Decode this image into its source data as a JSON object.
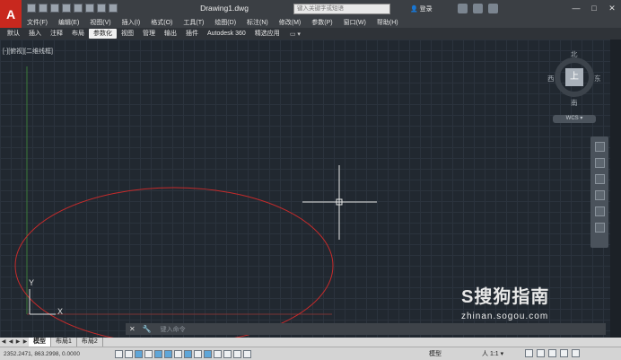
{
  "app": {
    "logo_letter": "A",
    "doc_title": "Drawing1.dwg"
  },
  "search": {
    "placeholder": "键入关键字或短语"
  },
  "login": {
    "label": "登录"
  },
  "window_buttons": {
    "minimize": "—",
    "maximize": "□",
    "close": "✕"
  },
  "menus": [
    "文件(F)",
    "编辑(E)",
    "视图(V)",
    "插入(I)",
    "格式(O)",
    "工具(T)",
    "绘图(D)",
    "标注(N)",
    "修改(M)",
    "参数(P)",
    "窗口(W)",
    "帮助(H)"
  ],
  "ribbon_tabs": [
    {
      "label": "默认",
      "active": false
    },
    {
      "label": "插入",
      "active": false
    },
    {
      "label": "注释",
      "active": false
    },
    {
      "label": "布局",
      "active": false
    },
    {
      "label": "参数化",
      "active": true
    },
    {
      "label": "视图",
      "active": false
    },
    {
      "label": "管理",
      "active": false
    },
    {
      "label": "输出",
      "active": false
    },
    {
      "label": "插件",
      "active": false
    },
    {
      "label": "Autodesk 360",
      "active": false
    },
    {
      "label": "精选应用",
      "active": false
    }
  ],
  "ribbon_more": "▭ ▾",
  "viewport": {
    "label": "[-][俯视][二维线框]"
  },
  "viewcube": {
    "north": "北",
    "south": "南",
    "east": "东",
    "west": "西",
    "face": "上",
    "wcs": "WCS ▾"
  },
  "ucs": {
    "x_label": "X",
    "y_label": "Y"
  },
  "command": {
    "placeholder": "键入命令",
    "close": "✕",
    "tool": "🔧"
  },
  "watermark": {
    "logo": "S搜狗指南",
    "url": "zhinan.sogou.com"
  },
  "layout_tabs": [
    {
      "label": "模型",
      "active": true
    },
    {
      "label": "布局1",
      "active": false
    },
    {
      "label": "布局2",
      "active": false
    }
  ],
  "status": {
    "coords": "2352.2471, 863.2998, 0.0000",
    "model": "模型",
    "scale": "人 1:1 ▾"
  },
  "colors": {
    "canvas": "#212830",
    "ellipse": "#c62b2b",
    "ribbon_active": "#f0f0f0",
    "logo": "#c8281e"
  }
}
